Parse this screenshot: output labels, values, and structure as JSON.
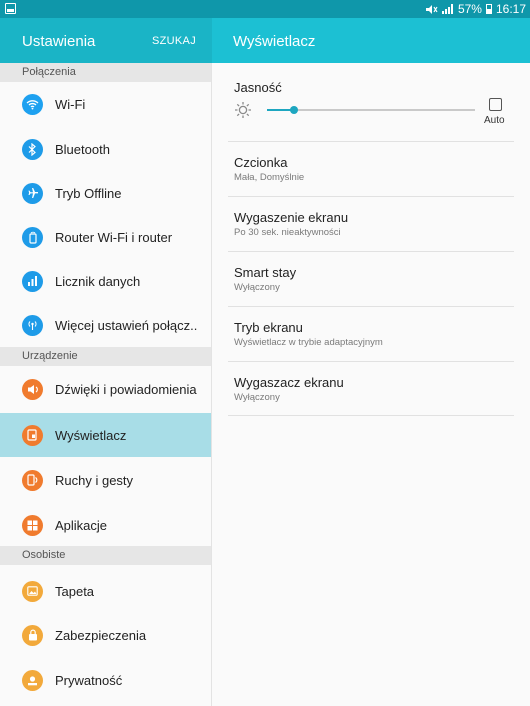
{
  "status_bar": {
    "battery_text": "57%",
    "time": "16:17"
  },
  "left_header": {
    "title": "Ustawienia",
    "search_label": "SZUKAJ"
  },
  "right_header": {
    "title": "Wyświetlacz"
  },
  "sections": {
    "connections": "Połączenia",
    "device": "Urządzenie",
    "personal": "Osobiste"
  },
  "menu": [
    {
      "label": "Wi-Fi",
      "color": "#1ea1f0",
      "icon": "wifi-icon"
    },
    {
      "label": "Bluetooth",
      "color": "#1e9be8",
      "icon": "bluetooth-icon"
    },
    {
      "label": "Tryb Offline",
      "color": "#1e9be8",
      "icon": "airplane-icon"
    },
    {
      "label": "Router Wi-Fi i router",
      "color": "#1e9be8",
      "icon": "hotspot-icon"
    },
    {
      "label": "Licznik danych",
      "color": "#1e9be8",
      "icon": "data-usage-icon"
    },
    {
      "label": "Więcej ustawień połącz..",
      "color": "#1e9be8",
      "icon": "more-connections-icon"
    },
    {
      "label": "Dźwięki i powiadomienia",
      "color": "#f07b2e",
      "icon": "sound-icon"
    },
    {
      "label": "Wyświetlacz",
      "color": "#f07b2e",
      "icon": "display-icon"
    },
    {
      "label": "Ruchy i gesty",
      "color": "#f07b2e",
      "icon": "motion-icon"
    },
    {
      "label": "Aplikacje",
      "color": "#f07b2e",
      "icon": "apps-icon"
    },
    {
      "label": "Tapeta",
      "color": "#f2a93b",
      "icon": "wallpaper-icon"
    },
    {
      "label": "Zabezpieczenia",
      "color": "#f2a93b",
      "icon": "lock-icon"
    },
    {
      "label": "Prywatność",
      "color": "#f2a93b",
      "icon": "privacy-icon"
    }
  ],
  "selected_item": "Wyświetlacz",
  "brightness": {
    "label": "Jasność",
    "level_fraction": 0.13,
    "auto_label": "Auto",
    "auto_checked": false
  },
  "settings": [
    {
      "title": "Czcionka",
      "subtitle": "Mała, Domyślnie"
    },
    {
      "title": "Wygaszenie ekranu",
      "subtitle": "Po 30 sek. nieaktywności"
    },
    {
      "title": "Smart stay",
      "subtitle": "Wyłączony"
    },
    {
      "title": "Tryb ekranu",
      "subtitle": "Wyświetlacz w trybie adaptacyjnym"
    },
    {
      "title": "Wygaszacz ekranu",
      "subtitle": "Wyłączony"
    }
  ],
  "accent_color": "#1cc0d3"
}
